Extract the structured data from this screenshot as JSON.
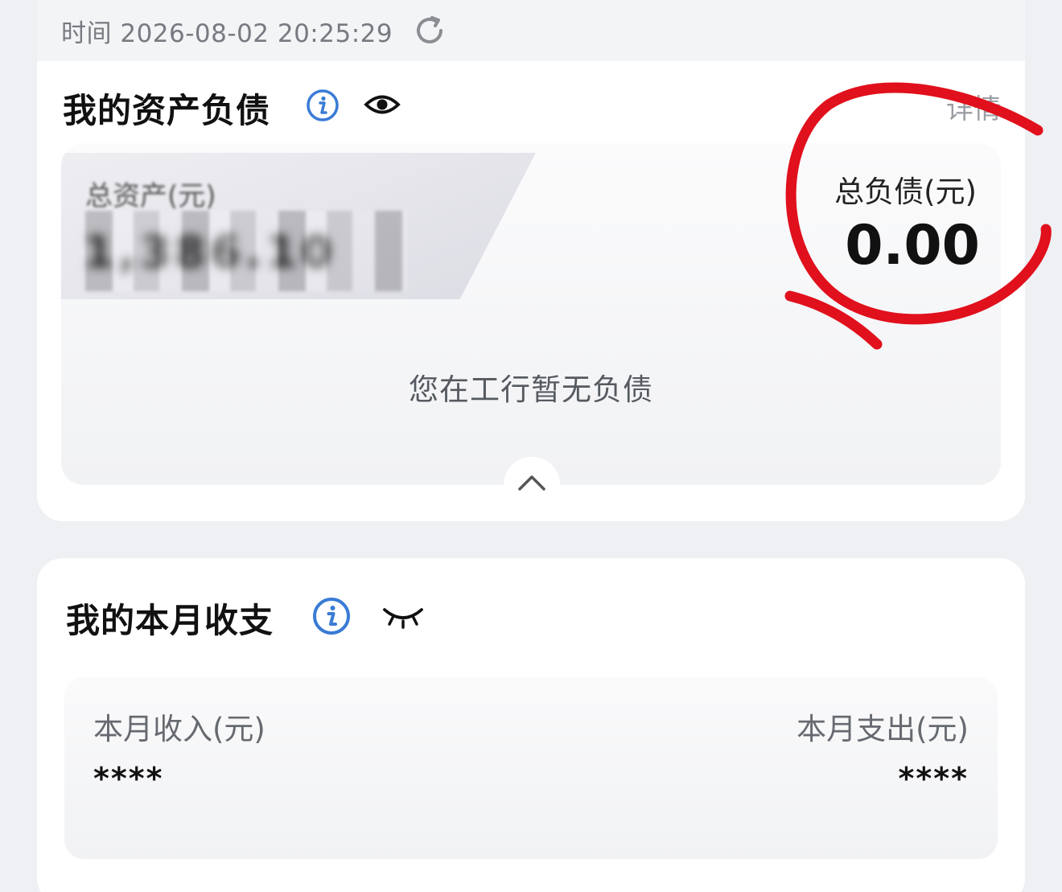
{
  "header": {
    "time_text": "时间 2026-08-02 20:25:29"
  },
  "assets_card": {
    "title": "我的资产负债",
    "detail_link": "详情",
    "total_assets_label": "总资产(元)",
    "total_assets_value": "1,386.10",
    "total_debt_label": "总负债(元)",
    "total_debt_value": "0.00",
    "empty_text": "您在工行暂无负债"
  },
  "monthly_card": {
    "title": "我的本月收支",
    "income_label": "本月收入(元)",
    "income_value": "****",
    "expense_label": "本月支出(元)",
    "expense_value": "****"
  },
  "colors": {
    "info_blue": "#3a7bd5",
    "annotation_red": "#e0101c",
    "text_gray": "#777a80"
  }
}
